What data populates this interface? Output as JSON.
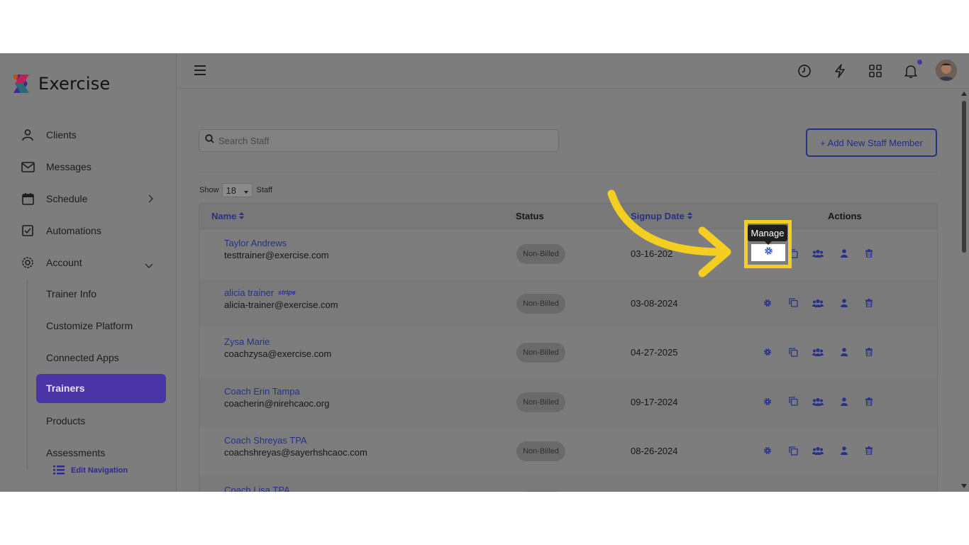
{
  "app": {
    "name": "Exercise"
  },
  "colors": {
    "accent": "#4a35a6",
    "link": "#27318a",
    "highlight": "#f4ce21"
  },
  "sidebar": {
    "items": [
      {
        "label": "Clients",
        "icon": "user-icon"
      },
      {
        "label": "Messages",
        "icon": "envelope-icon"
      },
      {
        "label": "Schedule",
        "icon": "calendar-icon"
      },
      {
        "label": "Automations",
        "icon": "check-square-icon"
      },
      {
        "label": "Account",
        "icon": "gear-icon"
      }
    ],
    "account_sub": [
      "Trainer Info",
      "Customize Platform",
      "Connected Apps",
      "Trainers",
      "Products",
      "Assessments"
    ],
    "active_sub": "Trainers",
    "edit_navigation": "Edit Navigation"
  },
  "topbar": {
    "icons": [
      "clock-icon",
      "lightning-icon",
      "apps-grid-icon",
      "bell-icon"
    ]
  },
  "search": {
    "placeholder": "Search Staff"
  },
  "add_button": {
    "label": "+ Add New Staff Member"
  },
  "pagination": {
    "show_label": "Show",
    "page_size": "18",
    "suffix": "Staff"
  },
  "table": {
    "headers": {
      "name": "Name",
      "status": "Status",
      "signup": "Signup Date",
      "actions": "Actions"
    },
    "rows": [
      {
        "name": "Taylor Andrews",
        "email": "testtrainer@exercise.com",
        "status": "Non-Billed",
        "date": "03-16-202",
        "stripe": ""
      },
      {
        "name": "alicia trainer",
        "email": "alicia-trainer@exercise.com",
        "status": "Non-Billed",
        "date": "03-08-2024",
        "stripe": "stripe"
      },
      {
        "name": "Zysa Marie",
        "email": "coachzysa@exercise.com",
        "status": "Non-Billed",
        "date": "04-27-2025",
        "stripe": ""
      },
      {
        "name": "Coach Erin Tampa",
        "email": "coacherin@nirehcaoc.org",
        "status": "Non-Billed",
        "date": "09-17-2024",
        "stripe": ""
      },
      {
        "name": "Coach Shreyas TPA",
        "email": "coachshreyas@sayerhshcaoc.com",
        "status": "Non-Billed",
        "date": "08-26-2024",
        "stripe": ""
      },
      {
        "name": "Coach Lisa TPA",
        "email": "",
        "status": "",
        "date": "",
        "stripe": ""
      }
    ]
  },
  "tooltip": {
    "label": "Manage"
  }
}
